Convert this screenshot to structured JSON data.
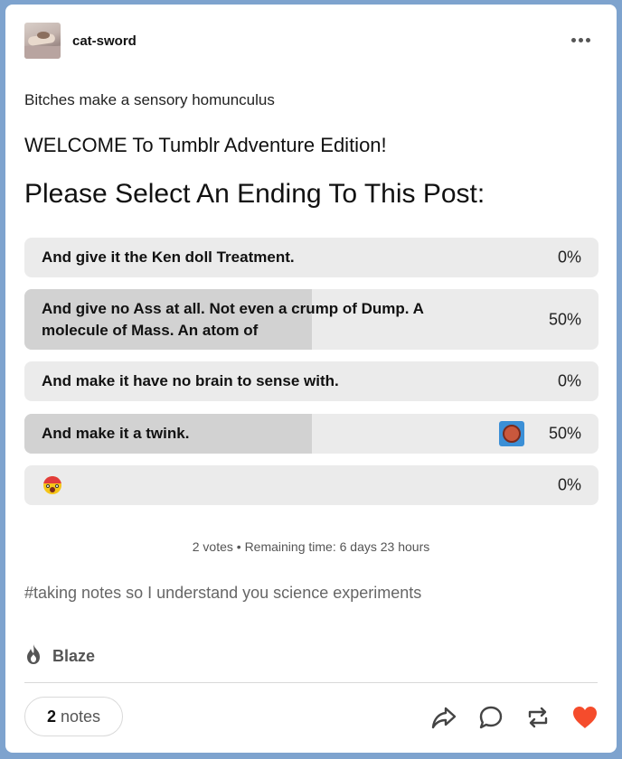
{
  "post": {
    "blog_name": "cat-sword",
    "text_line1": "Bitches make a sensory homunculus",
    "text_line2": "WELCOME To Tumblr Adventure Edition!",
    "heading": "Please Select An Ending To This Post:"
  },
  "poll": {
    "options": [
      {
        "label": "And give it the Ken doll Treatment.",
        "pct": "0%",
        "fill": 0
      },
      {
        "label": "And give no Ass at all. Not even a crump of Dump. A molecule of Mass. An atom of",
        "pct": "50%",
        "fill": 0.5
      },
      {
        "label": "And make it have no brain to sense with.",
        "pct": "0%",
        "fill": 0
      },
      {
        "label": "And make it a twink.",
        "pct": "50%",
        "fill": 0.5,
        "voter_avatar": "user-avatar"
      },
      {
        "label": "",
        "pct": "0%",
        "fill": 0,
        "emoji": "hot-face-emoji"
      }
    ],
    "meta": "2 votes • Remaining time: 6 days 23 hours"
  },
  "tags": "#taking notes so I understand you science experiments",
  "footer": {
    "blaze_label": "Blaze",
    "notes_count": "2",
    "notes_label": "notes"
  },
  "icons": [
    "more-icon",
    "flame-icon",
    "share-icon",
    "reply-icon",
    "reblog-icon",
    "like-icon"
  ],
  "colors": {
    "like": "#f54c2c",
    "background": "#7ea3ce"
  }
}
